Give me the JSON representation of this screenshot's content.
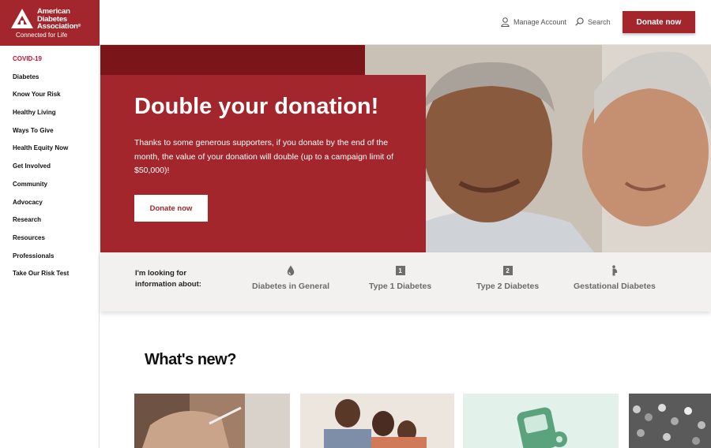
{
  "brand": {
    "name_line1": "American",
    "name_line2": "Diabetes",
    "name_line3": "Association",
    "registered": "®",
    "tagline": "Connected for Life",
    "color": "#a3262c"
  },
  "sidebar": {
    "items": [
      {
        "label": "COVID-19",
        "active": true
      },
      {
        "label": "Diabetes"
      },
      {
        "label": "Know Your Risk"
      },
      {
        "label": "Healthy Living"
      },
      {
        "label": "Ways To Give"
      },
      {
        "label": "Health Equity Now"
      },
      {
        "label": "Get Involved"
      },
      {
        "label": "Community"
      },
      {
        "label": "Advocacy"
      },
      {
        "label": "Research"
      },
      {
        "label": "Resources"
      },
      {
        "label": "Professionals"
      },
      {
        "label": "Take Our Risk Test"
      }
    ]
  },
  "header": {
    "manage_account": "Manage Account",
    "manage_icon": "user-icon",
    "search": "Search",
    "search_icon": "search-icon",
    "donate": "Donate now"
  },
  "hero": {
    "title": "Double your donation!",
    "body": "Thanks to some generous supporters, if you donate by the end of the month, the value of your donation will double (up to a campaign limit of $50,000)!",
    "button": "Donate now"
  },
  "info": {
    "label_line1": "I'm looking for",
    "label_line2": "information about:",
    "categories": [
      {
        "label": "Diabetes in General",
        "icon": "drop-icon"
      },
      {
        "label": "Type 1 Diabetes",
        "icon": "number-1-icon",
        "badge": "1"
      },
      {
        "label": "Type 2 Diabetes",
        "icon": "number-2-icon",
        "badge": "2"
      },
      {
        "label": "Gestational Diabetes",
        "icon": "pregnancy-icon"
      }
    ]
  },
  "whats_new": {
    "title": "What's new?"
  }
}
